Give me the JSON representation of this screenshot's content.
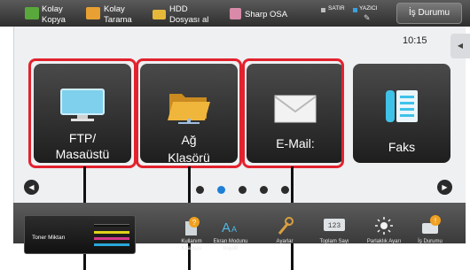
{
  "topbar": {
    "items": [
      {
        "label_line1": "Kolay",
        "label_line2": "Kopya"
      },
      {
        "label_line1": "Kolay",
        "label_line2": "Tarama"
      },
      {
        "label_line1": "HDD",
        "label_line2": "Dosyası al"
      },
      {
        "label_line1": "Sharp OSA"
      }
    ],
    "line_indicator": "SATIR",
    "printer_indicator": "YAZICI",
    "job_status_label": "İş Durumu"
  },
  "clock": "10:15",
  "tiles": [
    {
      "line1": "FTP/",
      "line2": "Masaüstü",
      "icon": "monitor-icon"
    },
    {
      "line1": "Ağ",
      "line2": "Klasörü",
      "icon": "folder-icon"
    },
    {
      "line1": "E-Mail:",
      "icon": "envelope-icon"
    },
    {
      "line1": "Faks",
      "icon": "fax-icon"
    }
  ],
  "pagination": {
    "count": 5,
    "active_index": 1
  },
  "statusbar": {
    "toner_label": "Toner Miktarı",
    "toner_colors": [
      "#111111",
      "#e0d31a",
      "#d63a8c",
      "#2aa7d8"
    ],
    "items": [
      {
        "label": "Kullanım Kılavuzu",
        "icon": "manual-icon"
      },
      {
        "label": "Ekran Modunu büyült",
        "icon": "enlarge-text-icon"
      },
      {
        "label": "Ayarlar",
        "icon": "settings-icon"
      },
      {
        "label": "Toplam Sayı",
        "icon": "counter-icon"
      },
      {
        "label": "Parlaklık Ayarı",
        "icon": "brightness-icon"
      },
      {
        "label": "İş Durumu",
        "icon": "job-status-icon"
      }
    ]
  },
  "colors": {
    "highlight": "#e2232e",
    "dot_active": "#1e7fd6",
    "tile_bg": "#2e2e2e"
  }
}
